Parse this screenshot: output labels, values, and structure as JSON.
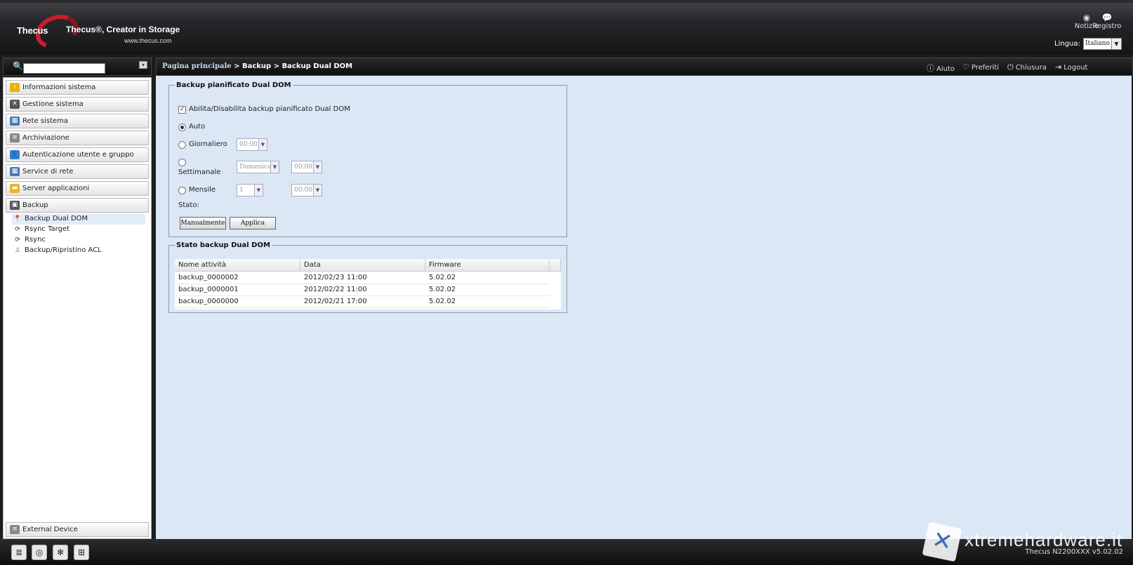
{
  "header": {
    "brand": "Thecus",
    "tagline": "Thecus®, Creator in Storage",
    "url": "www.thecus.com",
    "notizie": "Notizie",
    "registro": "Registro",
    "lingua_label": "Lingua:",
    "lingua_value": "Italiano"
  },
  "sidebar": {
    "search_placeholder": "",
    "categories": [
      {
        "label": "Informazioni sistema",
        "icon": "info-icon",
        "color": "#e6b400"
      },
      {
        "label": "Gestione sistema",
        "icon": "tools-icon",
        "color": "#555555"
      },
      {
        "label": "Rete sistema",
        "icon": "network-icon",
        "color": "#4a78b8"
      },
      {
        "label": "Archiviazione",
        "icon": "storage-icon",
        "color": "#888888"
      },
      {
        "label": "Autenticazione utente e gruppo",
        "icon": "users-icon",
        "color": "#3c7fc4"
      },
      {
        "label": "Service di rete",
        "icon": "network-service-icon",
        "color": "#4a78b8"
      },
      {
        "label": "Server applicazioni",
        "icon": "folder-icon",
        "color": "#e8b62a"
      },
      {
        "label": "Backup",
        "icon": "backup-icon",
        "color": "#555555"
      }
    ],
    "backup_items": [
      {
        "label": "Backup Dual DOM",
        "icon": "pin-icon"
      },
      {
        "label": "Rsync Target",
        "icon": "sync-icon"
      },
      {
        "label": "Rsync",
        "icon": "sync-icon"
      },
      {
        "label": "Backup/Ripristino ACL",
        "icon": "user-lock-icon"
      }
    ],
    "external_device": "External Device"
  },
  "breadcrumb": {
    "home": "Pagina principale",
    "sep": ">",
    "level1": "Backup",
    "level2": "Backup Dual DOM"
  },
  "top_actions": {
    "aiuto": "Aiuto",
    "preferiti": "Preferiti",
    "chiusura": "Chiusura",
    "logout": "Logout"
  },
  "schedule": {
    "legend": "Backup pianificato Dual DOM",
    "enable_label": "Abilita/Disabilita backup pianificato Dual DOM",
    "enabled": "✓",
    "auto": "Auto",
    "giornaliero": "Giornaliero",
    "settimanale": "Settimanale",
    "mensile": "Mensile",
    "daily_time": "00:00",
    "weekly_day": "Domenica",
    "weekly_time": "00:00",
    "monthly_day": "1",
    "monthly_time": "00:00",
    "stato": "Stato:",
    "btn_manual": "Manualmente",
    "btn_apply": "Applica"
  },
  "status": {
    "legend": "Stato backup Dual DOM",
    "columns": [
      "Nome attività",
      "Data",
      "Firmware"
    ],
    "rows": [
      [
        "backup_0000002",
        "2012/02/23 11:00",
        "5.02.02"
      ],
      [
        "backup_0000001",
        "2012/02/22 11:00",
        "5.02.02"
      ],
      [
        "backup_0000000",
        "2012/02/21 17:00",
        "5.02.02"
      ]
    ]
  },
  "footer": {
    "version": "Thecus N2200XXX v5.02.02"
  },
  "watermark": {
    "text": "xtremehardware.it"
  },
  "colors": {
    "main_bg": "#dbe7f5",
    "header_dark": "#141516",
    "accent_red": "#c81e2b"
  }
}
